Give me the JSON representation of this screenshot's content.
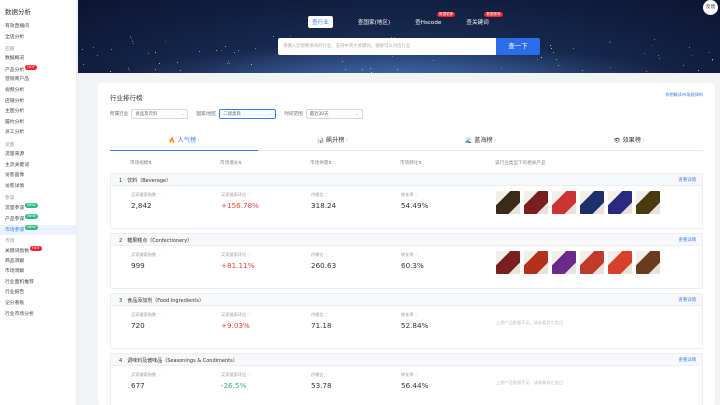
{
  "sidebar": {
    "brand": "数据分析",
    "items": [
      {
        "label": "有效直播间",
        "type": "item"
      },
      {
        "label": "全店分析",
        "type": "item"
      },
      {
        "label": "店铺",
        "type": "group"
      },
      {
        "label": "数据概况",
        "type": "item"
      },
      {
        "label": "产品分析",
        "type": "item",
        "badge": "HOT",
        "badge_color": "red"
      },
      {
        "label": "营销商户品",
        "type": "item"
      },
      {
        "label": "视频分析",
        "type": "item"
      },
      {
        "label": "店铺分析",
        "type": "item"
      },
      {
        "label": "主图分析",
        "type": "item"
      },
      {
        "label": "履约分析",
        "type": "item"
      },
      {
        "label": "员工分析",
        "type": "item"
      },
      {
        "label": "流量",
        "type": "group"
      },
      {
        "label": "流量来源",
        "type": "item"
      },
      {
        "label": "主流关键词",
        "type": "item"
      },
      {
        "label": "访客画像",
        "type": "item"
      },
      {
        "label": "访客详情",
        "type": "item"
      },
      {
        "label": "参谋",
        "type": "group"
      },
      {
        "label": "流量参谋",
        "type": "item",
        "badge": "NEW",
        "badge_color": "green"
      },
      {
        "label": "产品参谋",
        "type": "item",
        "badge": "NEW",
        "badge_color": "green"
      },
      {
        "label": "市场参谋",
        "type": "item",
        "badge": "NEW",
        "badge_color": "green",
        "active": true
      },
      {
        "label": "市场",
        "type": "group"
      },
      {
        "label": "关键词指数",
        "type": "item",
        "badge": "HOT",
        "badge_color": "red"
      },
      {
        "label": "商品洞察",
        "type": "item"
      },
      {
        "label": "市场洞察",
        "type": "item"
      },
      {
        "label": "行业面机推荐",
        "type": "item"
      },
      {
        "label": "行业报告",
        "type": "item"
      },
      {
        "label": "记分看板",
        "type": "item"
      },
      {
        "label": "行业市场分析",
        "type": "item"
      }
    ]
  },
  "hero": {
    "tabs": [
      {
        "label": "查行业",
        "active": true
      },
      {
        "label": "查国家(地区)"
      },
      {
        "label": "查Hscode",
        "badge": "数据更新"
      },
      {
        "label": "查关键词",
        "badge": "数据更新"
      }
    ],
    "search_placeholder": "请输入您想要查询的行业，支持中英文关键词，搜索可以对应行业",
    "search_button": "查一下",
    "feedback_label": "反馈"
  },
  "panel": {
    "title": "行业排行榜",
    "link": "你想解读市场规律吗",
    "filters": [
      {
        "label": "所属行业",
        "value": "食品及饮料"
      },
      {
        "label": "国家/地区",
        "value": "二级类目",
        "highlight": true
      },
      {
        "label": "时间范围",
        "value": "最近30天"
      }
    ],
    "rank_tabs": [
      {
        "icon": "flame-icon",
        "glyph": "🔥",
        "label": "人气榜",
        "active": true
      },
      {
        "icon": "bar-chart-icon",
        "glyph": "📊",
        "label": "飙升榜"
      },
      {
        "icon": "ocean-icon",
        "glyph": "🌊",
        "label": "蓝海榜"
      },
      {
        "icon": "eye-icon",
        "glyph": "👁",
        "label": "效果榜"
      }
    ],
    "columns": [
      "市场规模",
      "市场增长",
      "市场供需",
      "市场转化",
      "该行业类型下的相关产品"
    ],
    "rows": [
      {
        "rank": "1",
        "title": "饮料（Beverage）",
        "link": "查看详情",
        "metrics": [
          {
            "label": "买家搜索指数",
            "value": "2,842",
            "color": ""
          },
          {
            "label": "买家搜索环比",
            "value": "+156.78%",
            "color": "red"
          },
          {
            "label": "供需比",
            "value": "318.24",
            "color": ""
          },
          {
            "label": "转化率",
            "value": "54.49%",
            "color": ""
          }
        ],
        "images": [
          "bottle-a",
          "bottle-b",
          "bottle-c",
          "bottle-d",
          "bottle-e",
          "bottle-f"
        ]
      },
      {
        "rank": "2",
        "title": "糖果糕点（Confectionery）",
        "link": "查看详情",
        "metrics": [
          {
            "label": "买家搜索指数",
            "value": "999",
            "color": ""
          },
          {
            "label": "买家搜索环比",
            "value": "+81.11%",
            "color": "red"
          },
          {
            "label": "供需比",
            "value": "260.63",
            "color": ""
          },
          {
            "label": "转化率",
            "value": "60.3%",
            "color": ""
          }
        ],
        "images": [
          "snack-a",
          "snack-b",
          "snack-c",
          "snack-d",
          "snack-e",
          "snack-f"
        ]
      },
      {
        "rank": "3",
        "title": "食品添加剂（Food Ingredients）",
        "link": "查看详情",
        "metrics": [
          {
            "label": "买家搜索指数",
            "value": "720",
            "color": ""
          },
          {
            "label": "买家搜索环比",
            "value": "+9.03%",
            "color": "red"
          },
          {
            "label": "供需比",
            "value": "71.18",
            "color": ""
          },
          {
            "label": "转化率",
            "value": "52.84%",
            "color": ""
          }
        ],
        "empty_note": "上榜产品数量不足，请查看其它类目",
        "images": []
      },
      {
        "rank": "4",
        "title": "调味料及酱味品（Seasonings & Condiments）",
        "link": "查看详情",
        "metrics": [
          {
            "label": "买家搜索指数",
            "value": "677",
            "color": ""
          },
          {
            "label": "买家搜索环比",
            "value": "-26.5%",
            "color": "green"
          },
          {
            "label": "供需比",
            "value": "53.78",
            "color": ""
          },
          {
            "label": "转化率",
            "value": "56.44%",
            "color": ""
          }
        ],
        "empty_note": "上榜产品数量不足，请查看其它类目",
        "images": []
      }
    ]
  }
}
